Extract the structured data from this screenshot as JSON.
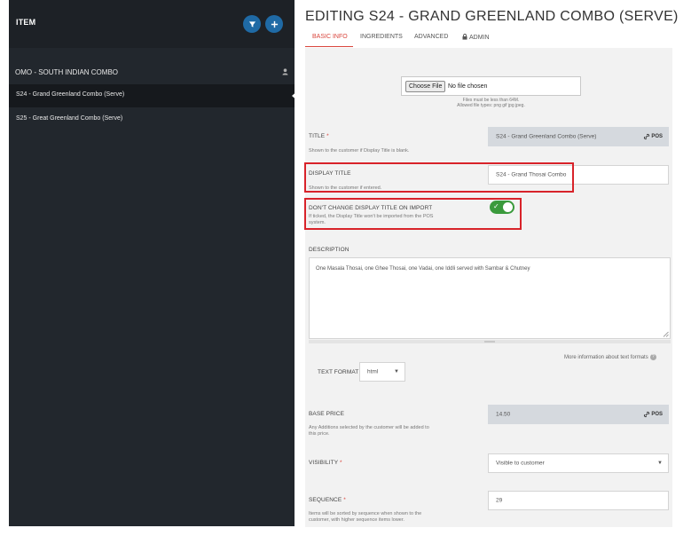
{
  "sidebar": {
    "header_title": "ITEM",
    "group_label": "OMO - SOUTH INDIAN COMBO",
    "items": [
      {
        "label": "S24 - Grand Greenland Combo (Serve)",
        "active": true
      },
      {
        "label": "S25 - Great Greenland Combo (Serve)",
        "active": false
      }
    ]
  },
  "main": {
    "title": "EDITING S24 - GRAND GREENLAND COMBO (SERVE)",
    "tabs": [
      {
        "label": "BASIC INFO",
        "active": true
      },
      {
        "label": "INGREDIENTS",
        "active": false
      },
      {
        "label": "ADVANCED",
        "active": false
      },
      {
        "label": "ADMIN",
        "active": false
      }
    ]
  },
  "form": {
    "file": {
      "button_label": "Choose File",
      "status": "No file chosen",
      "hint_size": "Files must be less than 64M.",
      "hint_types": "Allowed file types: png gif jpg jpeg."
    },
    "title": {
      "label": "TITLE",
      "required_mark": "*",
      "hint": "Shown to the customer if Display Title is blank.",
      "value": "S24 - Grand Greenland Combo (Serve)",
      "tag": "POS"
    },
    "display_title": {
      "label": "DISPLAY TITLE",
      "hint": "Shown to the customer if entered.",
      "value": "S24 - Grand Thosai Combo"
    },
    "dont_change": {
      "label": "DON'T CHANGE DISPLAY TITLE ON IMPORT",
      "hint_line1": "If ticked, the Display Title won't be imported from the POS",
      "hint_line2": "system.",
      "checked": true
    },
    "description": {
      "label": "DESCRIPTION",
      "value": "One Masala Thosai, one Ghee Thosai, one Vadai, one Iddli served with Sambar & Chutney"
    },
    "more_info": "More information about text formats",
    "text_format": {
      "label": "TEXT FORMAT",
      "value": "html"
    },
    "base_price": {
      "label": "BASE PRICE",
      "hint_line1": "Any Additions selected by the customer will be added to",
      "hint_line2": "this price.",
      "value": "14.50",
      "tag": "POS"
    },
    "visibility": {
      "label": "VISIBILITY",
      "required_mark": "*",
      "value": "Visible to customer"
    },
    "sequence": {
      "label": "SEQUENCE",
      "required_mark": "*",
      "hint_line1": "Items will be sorted by sequence when shown to the",
      "hint_line2": "customer, with higher sequence items lower.",
      "value": "29"
    }
  },
  "colors": {
    "sidebar_bg": "#22272d",
    "accent_blue": "#1f6aa5",
    "tab_active": "#d9463d",
    "highlight_red": "#d8232a",
    "toggle_green": "#3a9a3c"
  },
  "icons": [
    "filter-icon",
    "plus-icon",
    "person-icon",
    "lock-icon",
    "link-icon",
    "help-icon",
    "chevron-down-icon",
    "check-icon"
  ]
}
